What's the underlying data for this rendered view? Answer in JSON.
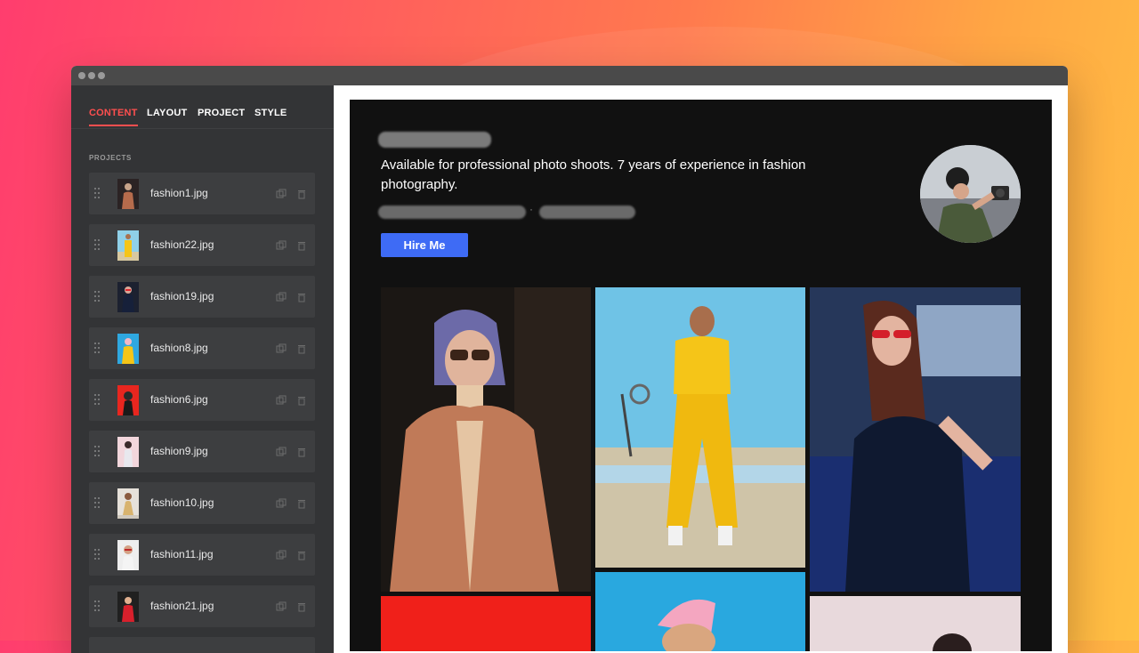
{
  "sidebar": {
    "tabs": [
      {
        "label": "CONTENT",
        "active": true
      },
      {
        "label": "LAYOUT",
        "active": false
      },
      {
        "label": "PROJECT",
        "active": false
      },
      {
        "label": "STYLE",
        "active": false
      }
    ],
    "section_label": "PROJECTS",
    "items": [
      {
        "file": "fashion1.jpg"
      },
      {
        "file": "fashion22.jpg"
      },
      {
        "file": "fashion19.jpg"
      },
      {
        "file": "fashion8.jpg"
      },
      {
        "file": "fashion6.jpg"
      },
      {
        "file": "fashion9.jpg"
      },
      {
        "file": "fashion10.jpg"
      },
      {
        "file": "fashion11.jpg"
      },
      {
        "file": "fashion21.jpg"
      }
    ],
    "item_icons": [
      "drag-handle-icon",
      "duplicate-icon",
      "trash-icon"
    ]
  },
  "preview": {
    "bio": "Available for professional photo shoots. 7 years of experience in fashion photography.",
    "hire_label": "Hire Me",
    "contact_separator": "·"
  },
  "colors": {
    "accent_tab": "#ff4f4f",
    "hire_button": "#3e6bf5",
    "sidebar_bg": "#333436",
    "preview_bg": "#111111"
  }
}
